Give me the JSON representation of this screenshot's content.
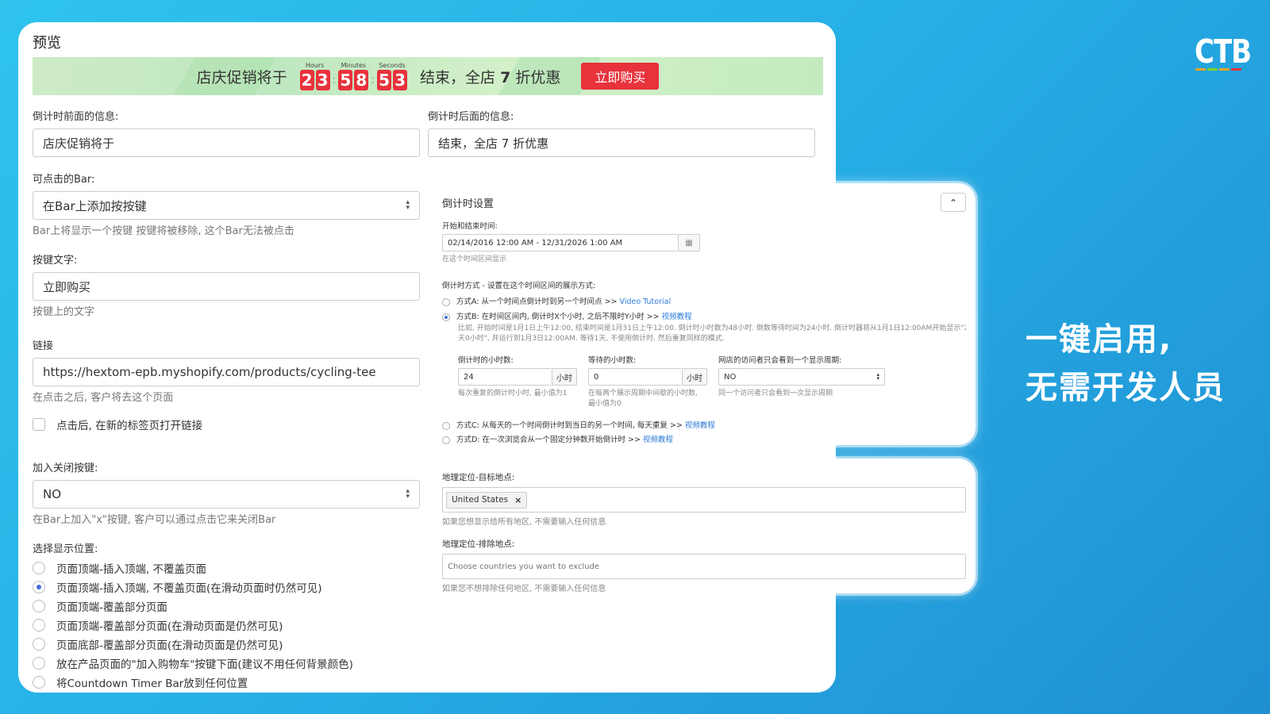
{
  "preview": {
    "title": "预览",
    "bar": {
      "before_text": "店庆促销将于",
      "after_text_1": "结束，全店",
      "after_text_bold": "7",
      "after_text_2": "折优惠",
      "button_label": "立即购买",
      "countdown": {
        "hours_label": "Hours",
        "hours": [
          "2",
          "3"
        ],
        "minutes_label": "Minutes",
        "minutes": [
          "5",
          "8"
        ],
        "seconds_label": "Seconds",
        "seconds": [
          "5",
          "3"
        ]
      }
    }
  },
  "form": {
    "before_msg_label": "倒计时前面的信息:",
    "before_msg_value": "店庆促销将于",
    "after_msg_label": "倒计时后面的信息:",
    "after_msg_value": "结束，全店 7 折优惠",
    "clickable_label": "可点击的Bar:",
    "clickable_value": "在Bar上添加按按键",
    "clickable_help": "Bar上将显示一个按键 按键将被移除, 这个Bar无法被点击",
    "button_text_label": "按键文字:",
    "button_text_value": "立即购买",
    "button_text_help": "按键上的文字",
    "link_label": "链接",
    "link_value": "https://hextom-epb.myshopify.com/products/cycling-tee",
    "link_help": "在点击之后, 客户将去这个页面",
    "new_tab_label": "点击后, 在新的标签页打开链接",
    "close_label": "加入关闭按键:",
    "close_value": "NO",
    "close_help": "在Bar上加入\"x\"按键, 客户可以通过点击它来关闭Bar",
    "position_label": "选择显示位置:",
    "positions": [
      {
        "label": "页面顶端-插入顶端, 不覆盖页面",
        "checked": false
      },
      {
        "label": "页面顶端-插入顶端, 不覆盖页面(在滑动页面时仍然可见)",
        "checked": true
      },
      {
        "label": "页面顶端-覆盖部分页面",
        "checked": false
      },
      {
        "label": "页面顶端-覆盖部分页面(在滑动页面是仍然可见)",
        "checked": false
      },
      {
        "label": "页面底部-覆盖部分页面(在滑动页面是仍然可见)",
        "checked": false
      },
      {
        "label": "放在产品页面的\"加入购物车\"按键下面(建议不用任何背景颜色)",
        "checked": false
      },
      {
        "label": "将Countdown Timer Bar放到任何位置",
        "checked": false
      }
    ]
  },
  "countdown_settings": {
    "title": "倒计时设置",
    "range_label": "开始和结束时间:",
    "range_value": "02/14/2016 12:00 AM - 12/31/2026 1:00 AM",
    "range_help": "在这个时间区间显示",
    "mode_label": "倒计时方式 - 设置在这个时间区间的展示方式:",
    "mode_a": "方式A: 从一个时间点倒计时到另一个时间点 >>",
    "mode_a_link": "Video Tutorial",
    "mode_b": "方式B: 在时间区间内, 倒计时X个小时, 之后不限时Y小时 >>",
    "mode_b_link": "视频教程",
    "mode_b_desc1": "比如, 开始时间是1月1日上午12:00, 结束时间是1月31日上午12:00. 倒计时小时数为48小时. 倒数等待时间为24小时. 倒计时器将从1月1日12:00AM开始显示\"2",
    "mode_b_desc2": "天0小时\", 并运行到1月3日12:00AM. 等待1天, 不使用倒计时. 然后重复同样的模式.",
    "hours_label": "倒计时的小时数:",
    "hours_value": "24",
    "hours_unit": "小时",
    "hours_help": "每次重复的倒计时小时, 最小值为1",
    "wait_label": "等待的小时数:",
    "wait_value": "0",
    "wait_unit": "小时",
    "wait_help1": "在每两个展示周期中间歇的小时数,",
    "wait_help2": "最小值为0",
    "visitor_label": "网店的访问者只会看到一个显示周期:",
    "visitor_value": "NO",
    "visitor_help": "同一个访问者只会看到一次显示周期",
    "mode_c": "方式C: 从每天的一个时间倒计时到当日的另一个时间, 每天重复 >>",
    "mode_c_link": "视频教程",
    "mode_d": "方式D: 在一次浏览会从一个固定分钟数开始倒计时 >>",
    "mode_d_link": "视频教程"
  },
  "geo": {
    "target_label": "地理定位-目标地点:",
    "target_tag": "United States",
    "target_help": "如果您想显示给所有地区, 不需要输入任何信息",
    "exclude_label": "地理定位-排除地点:",
    "exclude_placeholder": "Choose countries you want to exclude",
    "exclude_help": "如果您不想排除任何地区, 不需要输入任何信息"
  },
  "brand": {
    "logo": "CTB",
    "slogan_line1": "一键启用,",
    "slogan_line2": "无需开发人员",
    "stripe_colors": [
      "#f5a623",
      "#7ed321",
      "#f5a623",
      "#e8323c"
    ]
  }
}
